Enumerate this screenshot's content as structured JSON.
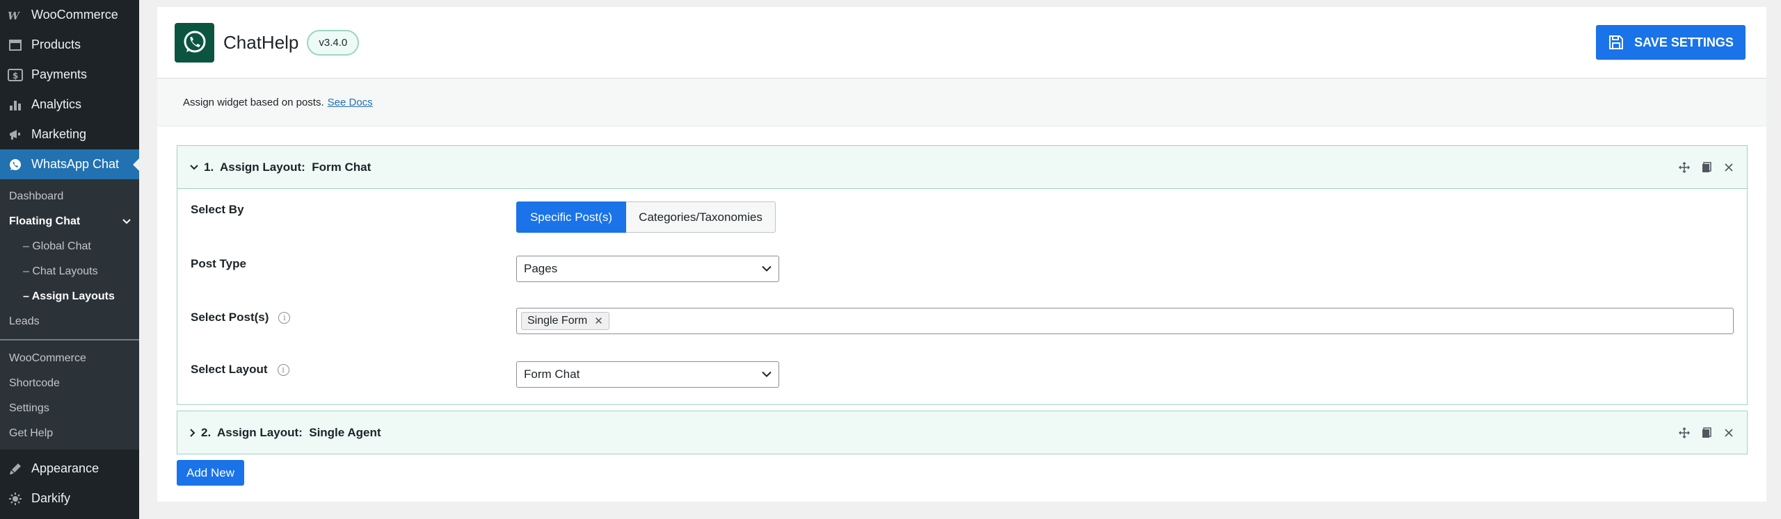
{
  "sidebar": {
    "top_items": [
      {
        "label": "WooCommerce",
        "icon": "woo-icon"
      },
      {
        "label": "Products",
        "icon": "products-icon"
      },
      {
        "label": "Payments",
        "icon": "payments-icon"
      },
      {
        "label": "Analytics",
        "icon": "analytics-icon"
      },
      {
        "label": "Marketing",
        "icon": "marketing-icon"
      }
    ],
    "active_item": {
      "label": "WhatsApp Chat",
      "icon": "whatsapp-icon"
    },
    "submenu": {
      "dashboard": "Dashboard",
      "floating_chat": "Floating Chat",
      "global_chat": "– Global Chat",
      "chat_layouts": "– Chat Layouts",
      "assign_layouts": "– Assign Layouts",
      "leads": "Leads",
      "woocommerce": "WooCommerce",
      "shortcode": "Shortcode",
      "settings": "Settings",
      "get_help": "Get Help"
    },
    "bottom_items": [
      {
        "label": "Appearance",
        "icon": "appearance-icon"
      },
      {
        "label": "Darkify",
        "icon": "darkify-icon"
      }
    ]
  },
  "header": {
    "app_name": "ChatHelp",
    "version": "v3.4.0",
    "save_label": "SAVE SETTINGS"
  },
  "notice": {
    "text": "Assign widget based on posts.",
    "link_text": "See Docs"
  },
  "layouts": [
    {
      "title": "1.  Assign Layout:  Form Chat",
      "expanded": true,
      "fields": {
        "select_by_label": "Select By",
        "select_by_options": [
          "Specific Post(s)",
          "Categories/Taxonomies"
        ],
        "select_by_selected": "Specific Post(s)",
        "post_type_label": "Post Type",
        "post_type_value": "Pages",
        "select_posts_label": "Select Post(s)",
        "selected_posts": [
          "Single Form"
        ],
        "select_layout_label": "Select Layout",
        "select_layout_value": "Form Chat"
      }
    },
    {
      "title": "2.  Assign Layout:  Single Agent",
      "expanded": false
    }
  ],
  "add_new_label": "Add New",
  "colors": {
    "sidebar_bg": "#1d2327",
    "accent_blue": "#1a73e8",
    "wp_blue": "#2271b1",
    "mint_border": "#9ed3c5",
    "mint_bg": "#effaf7",
    "logo_green": "#0b5540"
  }
}
